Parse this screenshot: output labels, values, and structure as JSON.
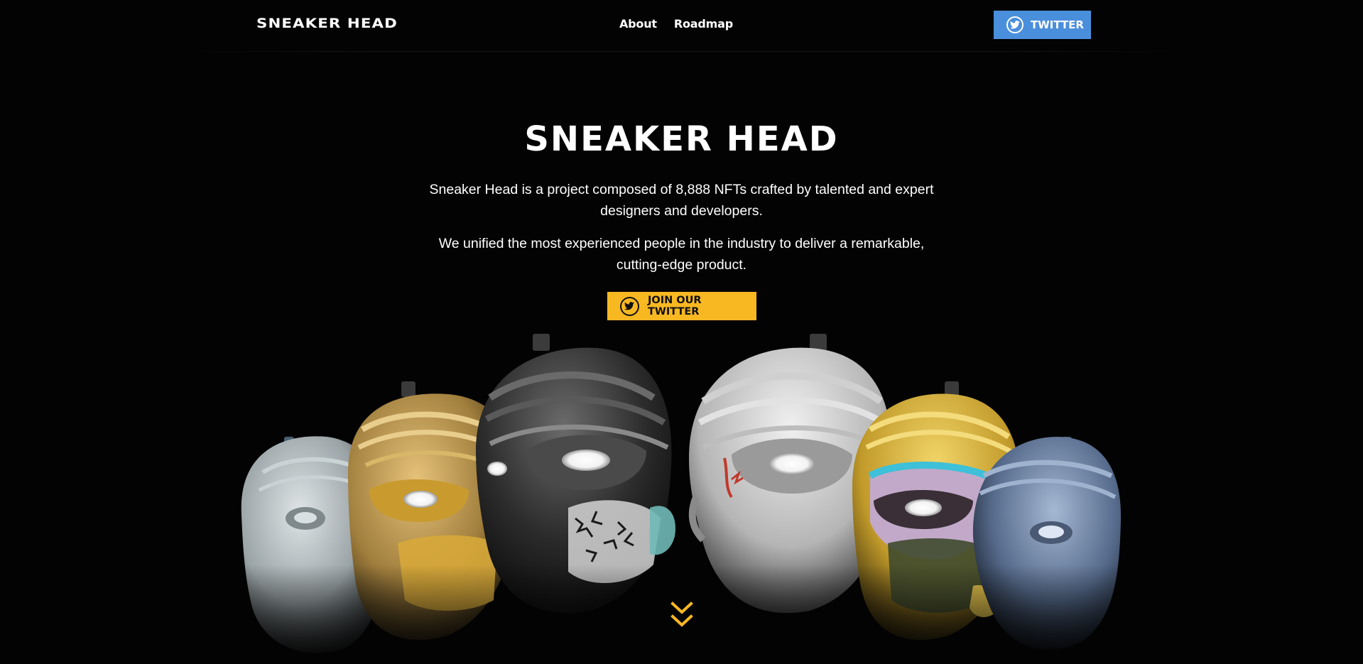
{
  "header": {
    "logo_text": "SNEAKER HEAD",
    "nav": [
      {
        "label": "About"
      },
      {
        "label": "Roadmap"
      }
    ],
    "twitter_button": {
      "label": "TWITTER",
      "icon": "twitter-bird-icon",
      "color": "#4a8fdc"
    }
  },
  "hero": {
    "title": "SNEAKER HEAD",
    "paragraphs": [
      "Sneaker Head is a project composed of 8,888 NFTs crafted by talented and expert designers and developers.",
      "We unified the most experienced people in the industry to deliver a remarkable, cutting-edge product."
    ],
    "cta": {
      "label": "JOIN OUR TWITTER",
      "icon": "twitter-bird-icon",
      "color": "#f8b822"
    }
  },
  "illustration": {
    "name": "sneaker-mask-heads",
    "mask_colors": [
      "#b9c3c6",
      "#c9a35a",
      "#3a3a3a",
      "#d9d9d9",
      "#e6c44a",
      "#6f86a8"
    ]
  },
  "scroll_indicator": {
    "icon": "double-chevron-down-icon",
    "color": "#f8b822"
  }
}
